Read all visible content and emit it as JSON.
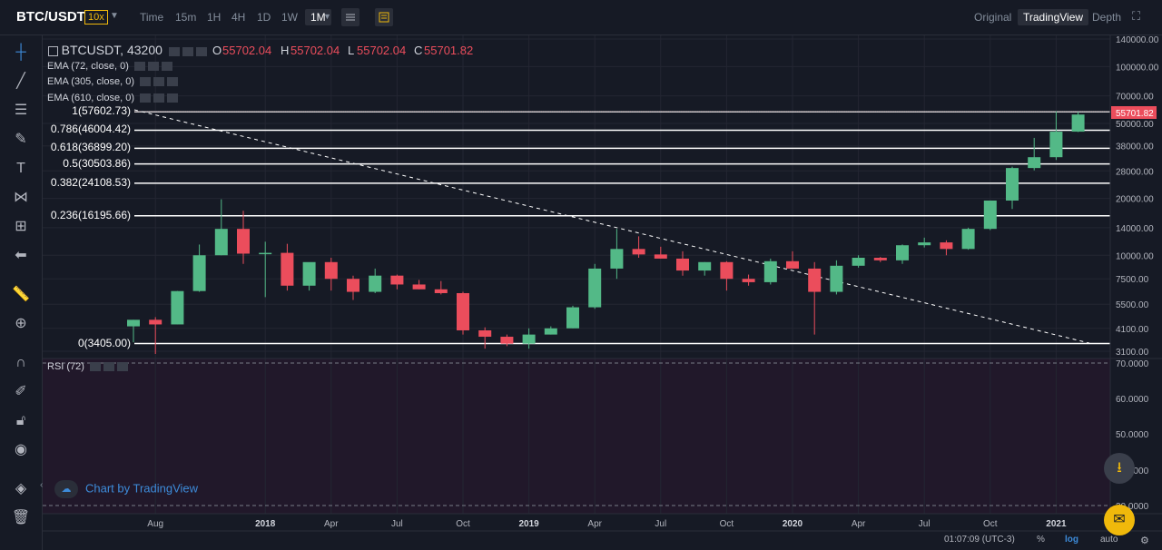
{
  "header": {
    "pair": "BTC/USDT",
    "leverage": "10x",
    "timeframes": [
      "Time",
      "15m",
      "1H",
      "4H",
      "1D",
      "1W",
      "1M"
    ],
    "active_timeframe": "1M",
    "views": [
      "Original",
      "TradingView",
      "Depth"
    ],
    "active_view": "TradingView"
  },
  "legend": {
    "symbol": "BTCUSDT, 43200",
    "o_label": "O",
    "o": "55702.04",
    "h_label": "H",
    "h": "55702.04",
    "l_label": "L",
    "l": "55702.04",
    "c_label": "C",
    "c": "55701.82",
    "ema1": "EMA (72, close, 0)",
    "ema2": "EMA (305, close, 0)",
    "ema3": "EMA (610, close, 0)"
  },
  "fib_levels": [
    {
      "label": "1(57602.73)",
      "value": 57602.73
    },
    {
      "label": "0.786(46004.42)",
      "value": 46004.42
    },
    {
      "label": "0.618(36899.20)",
      "value": 36899.2
    },
    {
      "label": "0.5(30503.86)",
      "value": 30503.86
    },
    {
      "label": "0.382(24108.53)",
      "value": 24108.53
    },
    {
      "label": "0.236(16195.66)",
      "value": 16195.66
    },
    {
      "label": "0(3405.00)",
      "value": 3405.0
    }
  ],
  "price_tag": "55701.82",
  "rsi": {
    "label": "RSI (72)",
    "ticks": [
      "70.0000",
      "60.0000",
      "50.0000",
      "40.0000",
      "30.0000"
    ]
  },
  "watermark": "Chart by TradingView",
  "footer": {
    "clock": "01:07:09 (UTC-3)",
    "pct": "%",
    "log": "log",
    "auto": "auto"
  },
  "colors": {
    "up": "#53b987",
    "down": "#eb4d5c",
    "bg": "#161a25",
    "grid": "#232632",
    "rsi_bg": "#21182a"
  },
  "chart_data": {
    "type": "candlestick",
    "title": "BTCUSDT, 43200",
    "y_scale": "log",
    "ylim": [
      3100,
      140000
    ],
    "y_ticks": [
      140000,
      100000,
      70000,
      50000,
      38000,
      28000,
      20000,
      14000,
      10000,
      7500,
      5500,
      4100,
      3100
    ],
    "y_tick_labels": [
      "140000.00",
      "100000.00",
      "70000.00",
      "50000.00",
      "38000.00",
      "28000.00",
      "20000.00",
      "14000.00",
      "10000.00",
      "7500.00",
      "5500.00",
      "4100.00",
      "3100.00"
    ],
    "x_tick_labels": [
      "Aug",
      "2018",
      "Apr",
      "Jul",
      "Oct",
      "2019",
      "Apr",
      "Jul",
      "Oct",
      "2020",
      "Apr",
      "Jul",
      "Oct",
      "2021"
    ],
    "x_tick_months": [
      "2017-08",
      "2018-01",
      "2018-04",
      "2018-07",
      "2018-10",
      "2019-01",
      "2019-04",
      "2019-07",
      "2019-10",
      "2020-01",
      "2020-04",
      "2020-07",
      "2020-10",
      "2021-01"
    ],
    "candles": [
      {
        "t": "2017-07",
        "o": 4200,
        "h": 4550,
        "l": 3460,
        "c": 4550
      },
      {
        "t": "2017-08",
        "o": 4550,
        "h": 4700,
        "l": 3000,
        "c": 4300
      },
      {
        "t": "2017-09",
        "o": 4300,
        "h": 6470,
        "l": 4300,
        "c": 6460
      },
      {
        "t": "2017-10",
        "o": 6460,
        "h": 11400,
        "l": 6400,
        "c": 10000
      },
      {
        "t": "2017-11",
        "o": 10000,
        "h": 19800,
        "l": 10000,
        "c": 13800
      },
      {
        "t": "2017-12",
        "o": 13800,
        "h": 17200,
        "l": 9000,
        "c": 10200
      },
      {
        "t": "2018-01",
        "o": 10200,
        "h": 11800,
        "l": 6000,
        "c": 10300
      },
      {
        "t": "2018-02",
        "o": 10300,
        "h": 11500,
        "l": 6500,
        "c": 6900
      },
      {
        "t": "2018-03",
        "o": 6900,
        "h": 9000,
        "l": 6500,
        "c": 9200
      },
      {
        "t": "2018-04",
        "o": 9200,
        "h": 9700,
        "l": 6500,
        "c": 7500
      },
      {
        "t": "2018-05",
        "o": 7500,
        "h": 7800,
        "l": 5800,
        "c": 6400
      },
      {
        "t": "2018-06",
        "o": 6400,
        "h": 8500,
        "l": 6300,
        "c": 7800
      },
      {
        "t": "2018-07",
        "o": 7800,
        "h": 7900,
        "l": 6600,
        "c": 7000
      },
      {
        "t": "2018-08",
        "o": 7000,
        "h": 7400,
        "l": 6600,
        "c": 6600
      },
      {
        "t": "2018-09",
        "o": 6600,
        "h": 7300,
        "l": 6200,
        "c": 6300
      },
      {
        "t": "2018-10",
        "o": 6300,
        "h": 6400,
        "l": 3800,
        "c": 4000
      },
      {
        "t": "2018-11",
        "o": 4000,
        "h": 4150,
        "l": 3200,
        "c": 3700
      },
      {
        "t": "2018-12",
        "o": 3700,
        "h": 3800,
        "l": 3300,
        "c": 3400
      },
      {
        "t": "2019-01",
        "o": 3400,
        "h": 4100,
        "l": 3200,
        "c": 3800
      },
      {
        "t": "2019-02",
        "o": 3800,
        "h": 4200,
        "l": 3800,
        "c": 4100
      },
      {
        "t": "2019-03",
        "o": 4100,
        "h": 5400,
        "l": 4100,
        "c": 5300
      },
      {
        "t": "2019-04",
        "o": 5300,
        "h": 9000,
        "l": 5200,
        "c": 8500
      },
      {
        "t": "2019-05",
        "o": 8500,
        "h": 13800,
        "l": 7500,
        "c": 10800
      },
      {
        "t": "2019-06",
        "o": 10800,
        "h": 12600,
        "l": 9700,
        "c": 10100
      },
      {
        "t": "2019-07",
        "o": 10100,
        "h": 11100,
        "l": 9600,
        "c": 9600
      },
      {
        "t": "2019-08",
        "o": 9600,
        "h": 10500,
        "l": 7800,
        "c": 8300
      },
      {
        "t": "2019-09",
        "o": 8300,
        "h": 9200,
        "l": 7800,
        "c": 9200
      },
      {
        "t": "2019-10",
        "o": 9200,
        "h": 9300,
        "l": 6500,
        "c": 7500
      },
      {
        "t": "2019-11",
        "o": 7500,
        "h": 7900,
        "l": 6900,
        "c": 7200
      },
      {
        "t": "2019-12",
        "o": 7200,
        "h": 9600,
        "l": 7000,
        "c": 9300
      },
      {
        "t": "2020-01",
        "o": 9300,
        "h": 10500,
        "l": 8500,
        "c": 8500
      },
      {
        "t": "2020-02",
        "o": 8500,
        "h": 9200,
        "l": 3800,
        "c": 6400
      },
      {
        "t": "2020-03",
        "o": 6400,
        "h": 9400,
        "l": 6200,
        "c": 8800
      },
      {
        "t": "2020-04",
        "o": 8800,
        "h": 10000,
        "l": 8600,
        "c": 9700
      },
      {
        "t": "2020-05",
        "o": 9700,
        "h": 9800,
        "l": 9200,
        "c": 9400
      },
      {
        "t": "2020-06",
        "o": 9400,
        "h": 11400,
        "l": 9000,
        "c": 11300
      },
      {
        "t": "2020-07",
        "o": 11300,
        "h": 12400,
        "l": 11000,
        "c": 11700
      },
      {
        "t": "2020-08",
        "o": 11700,
        "h": 12000,
        "l": 10000,
        "c": 10800
      },
      {
        "t": "2020-09",
        "o": 10800,
        "h": 14000,
        "l": 10700,
        "c": 13800
      },
      {
        "t": "2020-10",
        "o": 13800,
        "h": 19500,
        "l": 13600,
        "c": 19500
      },
      {
        "t": "2020-11",
        "o": 19500,
        "h": 29500,
        "l": 17600,
        "c": 29000
      },
      {
        "t": "2020-12",
        "o": 29000,
        "h": 41900,
        "l": 28200,
        "c": 33100
      },
      {
        "t": "2021-01",
        "o": 33100,
        "h": 58000,
        "l": 32000,
        "c": 45200
      },
      {
        "t": "2021-02",
        "o": 45200,
        "h": 57600,
        "l": 45000,
        "c": 55700
      }
    ]
  }
}
